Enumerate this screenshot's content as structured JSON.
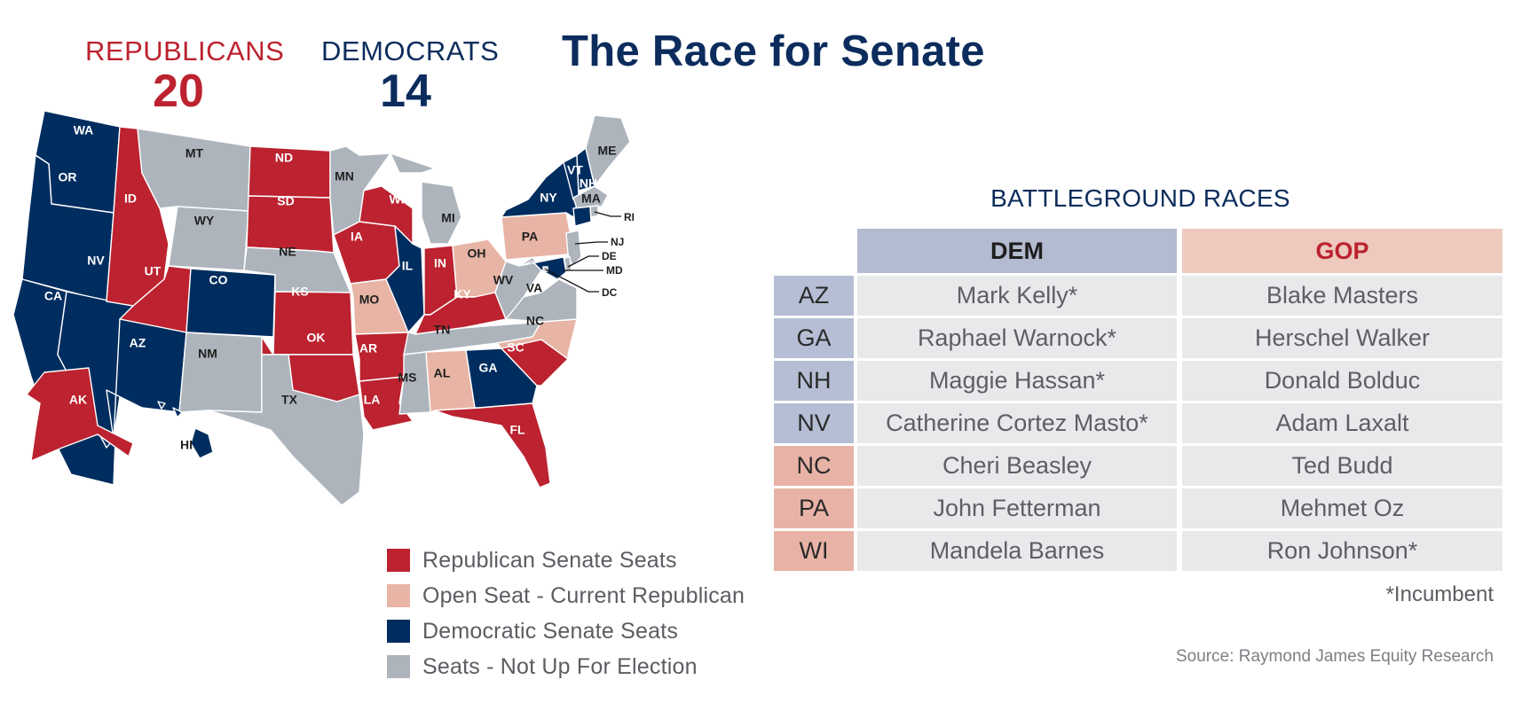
{
  "title": "The Race for Senate",
  "counts": {
    "republicans": {
      "label": "REPUBLICANS",
      "value": "20"
    },
    "democrats": {
      "label": "DEMOCRATS",
      "value": "14"
    }
  },
  "colors": {
    "republican": "#BC222F",
    "open_republican": "#E8B4A5",
    "democrat": "#002D5F",
    "not_up": "#ADB4BC"
  },
  "legend": [
    {
      "key": "republican",
      "label": "Republican Senate Seats"
    },
    {
      "key": "open_republican",
      "label": "Open Seat - Current Republican"
    },
    {
      "key": "democrat",
      "label": "Democratic Senate Seats"
    },
    {
      "key": "not_up",
      "label": "Seats - Not Up For Election"
    }
  ],
  "map": {
    "states": [
      {
        "code": "WA",
        "status": "democrat"
      },
      {
        "code": "OR",
        "status": "democrat"
      },
      {
        "code": "CA",
        "status": "democrat"
      },
      {
        "code": "NV",
        "status": "democrat"
      },
      {
        "code": "ID",
        "status": "republican"
      },
      {
        "code": "MT",
        "status": "not_up"
      },
      {
        "code": "WY",
        "status": "not_up"
      },
      {
        "code": "UT",
        "status": "republican"
      },
      {
        "code": "CO",
        "status": "democrat"
      },
      {
        "code": "AZ",
        "status": "democrat"
      },
      {
        "code": "NM",
        "status": "not_up"
      },
      {
        "code": "ND",
        "status": "republican"
      },
      {
        "code": "SD",
        "status": "republican"
      },
      {
        "code": "NE",
        "status": "not_up"
      },
      {
        "code": "KS",
        "status": "republican"
      },
      {
        "code": "OK",
        "status": "republican"
      },
      {
        "code": "TX",
        "status": "not_up"
      },
      {
        "code": "MN",
        "status": "not_up"
      },
      {
        "code": "IA",
        "status": "republican"
      },
      {
        "code": "MO",
        "status": "open_republican"
      },
      {
        "code": "AR",
        "status": "republican"
      },
      {
        "code": "LA",
        "status": "republican"
      },
      {
        "code": "WI",
        "status": "republican"
      },
      {
        "code": "IL",
        "status": "democrat"
      },
      {
        "code": "MI",
        "status": "not_up"
      },
      {
        "code": "IN",
        "status": "republican"
      },
      {
        "code": "OH",
        "status": "open_republican"
      },
      {
        "code": "KY",
        "status": "republican"
      },
      {
        "code": "TN",
        "status": "not_up"
      },
      {
        "code": "MS",
        "status": "not_up"
      },
      {
        "code": "AL",
        "status": "open_republican"
      },
      {
        "code": "GA",
        "status": "democrat"
      },
      {
        "code": "FL",
        "status": "republican"
      },
      {
        "code": "SC",
        "status": "republican"
      },
      {
        "code": "NC",
        "status": "open_republican"
      },
      {
        "code": "VA",
        "status": "not_up"
      },
      {
        "code": "WV",
        "status": "not_up"
      },
      {
        "code": "PA",
        "status": "open_republican"
      },
      {
        "code": "NY",
        "status": "democrat"
      },
      {
        "code": "VT",
        "status": "democrat"
      },
      {
        "code": "NH",
        "status": "democrat"
      },
      {
        "code": "ME",
        "status": "not_up"
      },
      {
        "code": "MA",
        "status": "not_up"
      },
      {
        "code": "CT",
        "status": "democrat"
      },
      {
        "code": "RI",
        "status": "not_up"
      },
      {
        "code": "NJ",
        "status": "not_up"
      },
      {
        "code": "DE",
        "status": "not_up"
      },
      {
        "code": "MD",
        "status": "democrat"
      },
      {
        "code": "DC",
        "status": "not_up"
      },
      {
        "code": "AK",
        "status": "republican"
      },
      {
        "code": "HI",
        "status": "democrat"
      }
    ],
    "callouts": [
      "RI",
      "NJ",
      "DE",
      "MD",
      "DC"
    ]
  },
  "battleground": {
    "title": "BATTLEGROUND RACES",
    "headers": {
      "dem": "DEM",
      "gop": "GOP"
    },
    "rows": [
      {
        "state": "AZ",
        "dem": "Mark Kelly*",
        "gop": "Blake Masters",
        "seat": "dem"
      },
      {
        "state": "GA",
        "dem": "Raphael Warnock*",
        "gop": "Herschel Walker",
        "seat": "dem"
      },
      {
        "state": "NH",
        "dem": "Maggie Hassan*",
        "gop": "Donald Bolduc",
        "seat": "dem"
      },
      {
        "state": "NV",
        "dem": "Catherine Cortez Masto*",
        "gop": "Adam Laxalt",
        "seat": "dem"
      },
      {
        "state": "NC",
        "dem": "Cheri Beasley",
        "gop": "Ted Budd",
        "seat": "gop"
      },
      {
        "state": "PA",
        "dem": "John Fetterman",
        "gop": "Mehmet Oz",
        "seat": "gop"
      },
      {
        "state": "WI",
        "dem": "Mandela Barnes",
        "gop": "Ron Johnson*",
        "seat": "gop"
      }
    ],
    "footnote": "*Incumbent"
  },
  "source": "Source: Raymond James Equity Research"
}
